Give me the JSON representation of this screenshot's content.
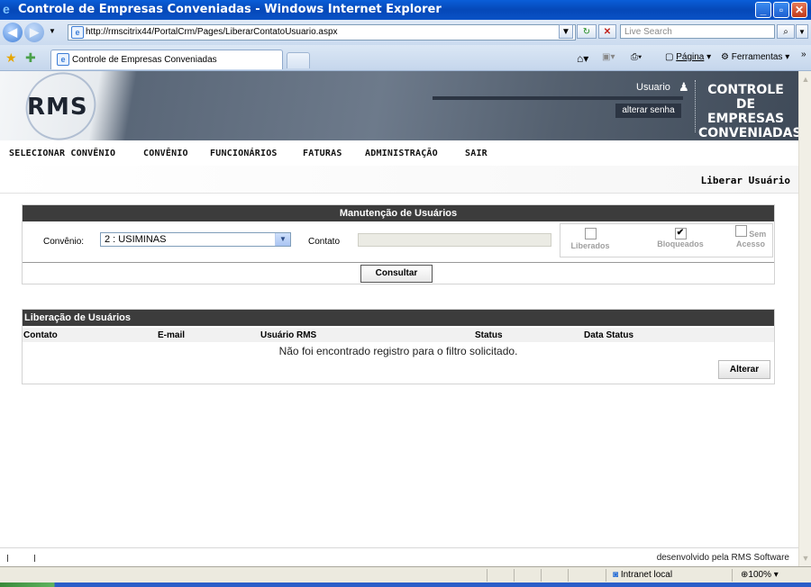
{
  "window": {
    "title": "Controle de Empresas Conveniadas - Windows Internet Explorer",
    "minimize": "_",
    "maximize": "▫",
    "close": "✕"
  },
  "browser": {
    "url": "http://rmscitrix44/PortalCrm/Pages/LiberarContatoUsuario.aspx",
    "search_placeholder": "Live Search",
    "tab_label": "Controle de Empresas Conveniadas",
    "commands": {
      "page": "Página",
      "tools": "Ferramentas"
    },
    "status_zone": "Intranet local",
    "zoom": "100%"
  },
  "header": {
    "logo": "RMS",
    "user_label": "Usuario",
    "change_password": "alterar senha",
    "brand_lines": [
      "CONTROLE",
      "DE EMPRESAS",
      "CONVENIADAS"
    ]
  },
  "menu": [
    "SELECIONAR CONVÊNIO",
    "CONVÊNIO",
    "FUNCIONÁRIOS",
    "FATURAS",
    "ADMINISTRAÇÃO",
    "SAIR"
  ],
  "page_title": "Liberar Usuário",
  "maintenance": {
    "title": "Manutenção de Usuários",
    "convenio_label": "Convênio:",
    "convenio_value": "2 : USIMINAS",
    "contato_label": "Contato",
    "contato_value": "",
    "checks": [
      {
        "label": "Liberados",
        "checked": false
      },
      {
        "label": "Bloqueados",
        "checked": true
      },
      {
        "label": "Sem",
        "label2": "Acesso",
        "checked": false
      }
    ],
    "consult_button": "Consultar"
  },
  "release": {
    "title": "Liberação de Usuários",
    "columns": [
      "Contato",
      "E-mail",
      "Usuário RMS",
      "Status",
      "Data Status"
    ],
    "empty_message": "Não foi encontrado registro para o filtro solicitado.",
    "alter_button": "Alterar"
  },
  "footer": {
    "credit": "desenvolvido pela RMS Software"
  }
}
